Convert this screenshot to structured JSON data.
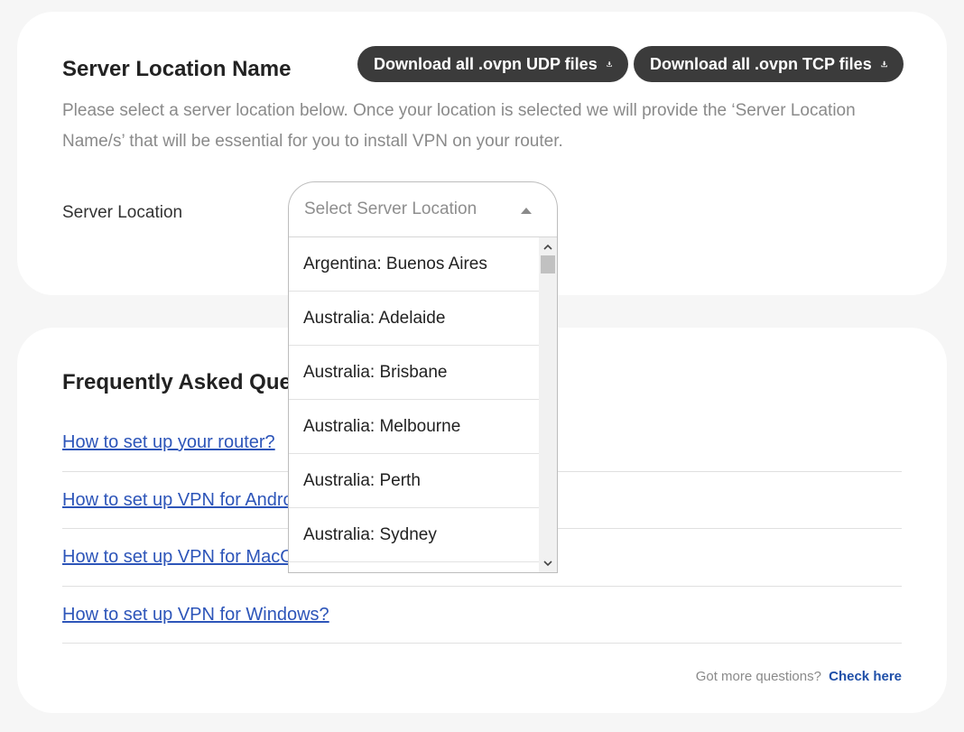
{
  "server_section": {
    "title": "Server Location Name",
    "udp_button_label": "Download all .ovpn UDP files",
    "tcp_button_label": "Download all .ovpn TCP files",
    "description": "Please select a server location below. Once your location is selected we will provide the ‘Server Location Name/s’ that will be essential for you to install VPN on your router.",
    "field_label": "Server Location",
    "select_placeholder": "Select Server Location",
    "options": [
      "Argentina: Buenos Aires",
      "Australia: Adelaide",
      "Australia: Brisbane",
      "Australia: Melbourne",
      "Australia: Perth",
      "Australia: Sydney"
    ]
  },
  "faq_section": {
    "title": "Frequently Asked Questions",
    "links": [
      "How to set up your router?",
      "How to set up VPN for Android?",
      "How to set up VPN for MacOS?",
      "How to set up VPN for Windows?"
    ],
    "more_text": "Got more questions?",
    "check_here_label": "Check here"
  },
  "icons": {
    "download": "download-icon",
    "caret": "caret-up-icon",
    "scroll_up": "scroll-up-arrow-icon",
    "scroll_down": "scroll-down-arrow-icon"
  },
  "colors": {
    "button_bg": "#3b3b3b",
    "link": "#2d55b9",
    "check_here": "#1f4fa8",
    "muted_text": "#8a8a8a",
    "page_bg": "#f6f6f6"
  }
}
